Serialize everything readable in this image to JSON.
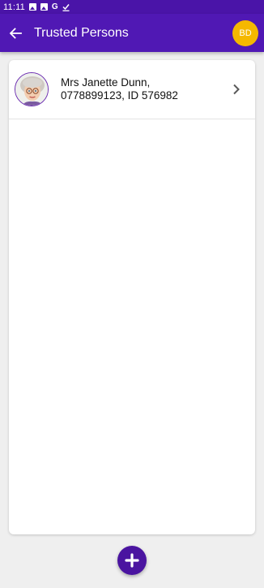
{
  "status_bar": {
    "time": "11:11",
    "icons": [
      "image-icon",
      "image-icon",
      "google-icon",
      "download-done-icon"
    ]
  },
  "app_bar": {
    "title": "Trusted Persons",
    "avatar_initials": "BD",
    "colors": {
      "bar": "#5018b4",
      "avatar": "#f5b800"
    }
  },
  "trusted_persons": [
    {
      "line1": "Mrs Janette Dunn,",
      "line2": "0778899123, ID 576982"
    }
  ],
  "fab": {
    "icon": "plus-icon",
    "color": "#4a14a0"
  }
}
